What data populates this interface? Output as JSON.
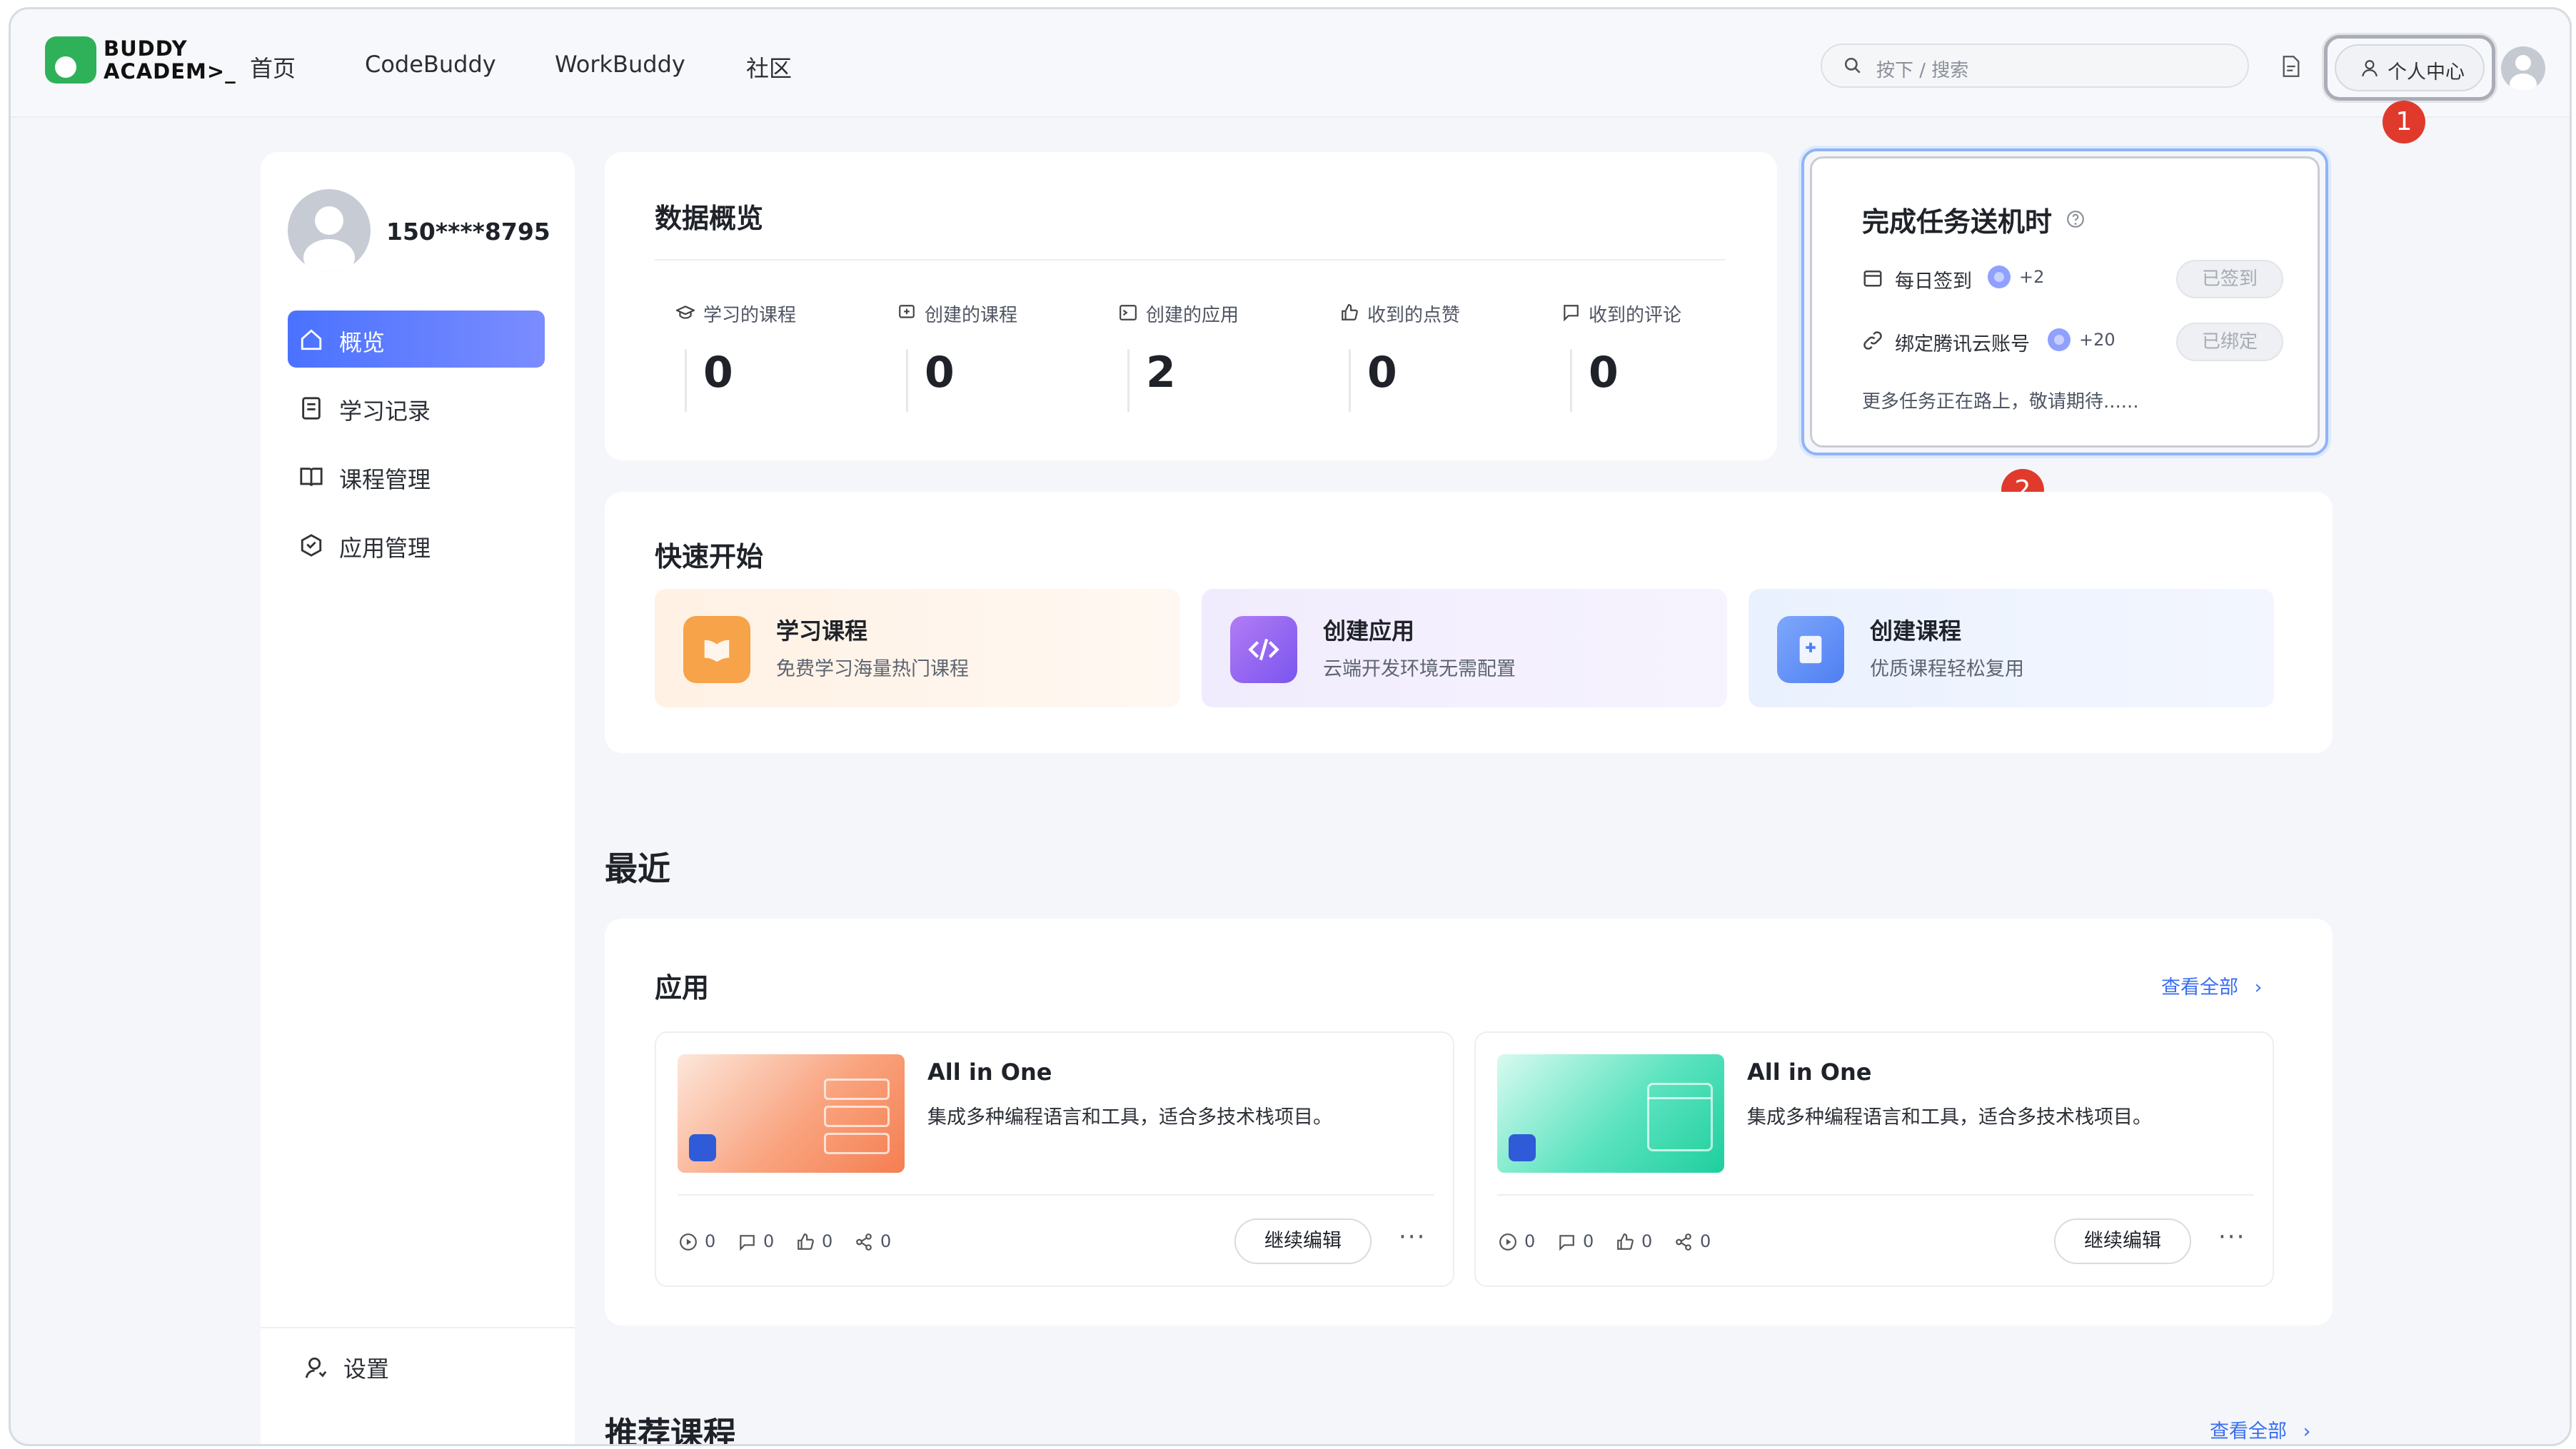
{
  "header": {
    "logo_line1": "BUDDY",
    "logo_line2": "ACADEM>_",
    "nav": [
      "首页",
      "CodeBuddy",
      "WorkBuddy",
      "社区"
    ],
    "search_placeholder": "按下 /  搜索",
    "profile_button": "个人中心"
  },
  "annotations": [
    "1",
    "2"
  ],
  "sidebar": {
    "username": "150****8795",
    "items": [
      {
        "label": "概览",
        "icon": "home-icon",
        "active": true
      },
      {
        "label": "学习记录",
        "icon": "record-icon",
        "active": false
      },
      {
        "label": "课程管理",
        "icon": "book-icon",
        "active": false
      },
      {
        "label": "应用管理",
        "icon": "app-hex-icon",
        "active": false
      }
    ],
    "settings_label": "设置"
  },
  "overview": {
    "title": "数据概览",
    "stats": [
      {
        "label": "学习的课程",
        "value": "0",
        "icon": "graduation-cap-icon"
      },
      {
        "label": "创建的课程",
        "value": "0",
        "icon": "course-create-icon"
      },
      {
        "label": "创建的应用",
        "value": "2",
        "icon": "terminal-icon"
      },
      {
        "label": "收到的点赞",
        "value": "0",
        "icon": "thumbs-up-icon"
      },
      {
        "label": "收到的评论",
        "value": "0",
        "icon": "comment-icon"
      }
    ]
  },
  "tasks": {
    "title": "完成任务送机时",
    "rows": [
      {
        "label": "每日签到",
        "bonus": "+2",
        "status": "已签到",
        "icon": "calendar-icon"
      },
      {
        "label": "绑定腾讯云账号",
        "bonus": "+20",
        "status": "已绑定",
        "icon": "link-icon"
      }
    ],
    "footer": "更多任务正在路上，敬请期待......"
  },
  "quick_start": {
    "title": "快速开始",
    "items": [
      {
        "title": "学习课程",
        "subtitle": "免费学习海量热门课程",
        "color": "#f6a34a"
      },
      {
        "title": "创建应用",
        "subtitle": "云端开发环境无需配置",
        "color": "#8e66f0"
      },
      {
        "title": "创建课程",
        "subtitle": "优质课程轻松复用",
        "color": "#5b8cf6"
      }
    ]
  },
  "recent": {
    "title": "最近",
    "apps_title": "应用",
    "view_all": "查看全部",
    "apps": [
      {
        "name": "All in One",
        "desc": "集成多种编程语言和工具，适合多技术栈项目。",
        "plays": "0",
        "comments": "0",
        "likes": "0",
        "shares": "0",
        "edit_label": "继续编辑",
        "more": "···",
        "theme": "#f7926a"
      },
      {
        "name": "All in One",
        "desc": "集成多种编程语言和工具，适合多技术栈项目。",
        "plays": "0",
        "comments": "0",
        "likes": "0",
        "shares": "0",
        "edit_label": "继续编辑",
        "more": "···",
        "theme": "#2fd7a8"
      }
    ]
  },
  "recommended": {
    "title": "推荐课程",
    "view_all": "查看全部"
  }
}
